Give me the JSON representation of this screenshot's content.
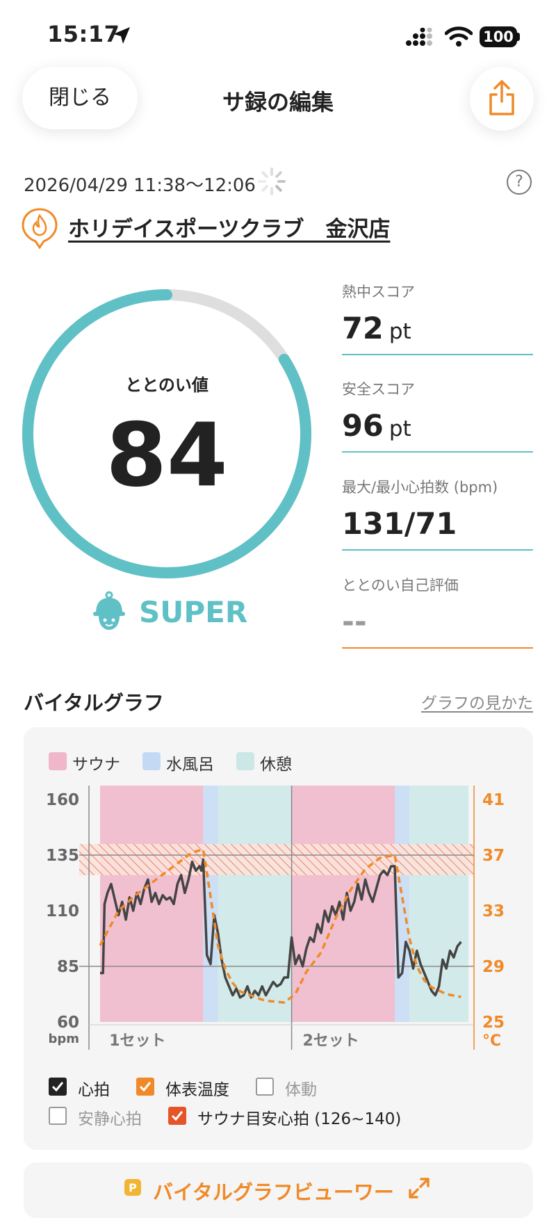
{
  "status_bar": {
    "time": "15:17",
    "battery": "100"
  },
  "header": {
    "close_label": "閉じる",
    "title": "サ録の編集"
  },
  "session": {
    "date": "2026/04/29 11:38～12:06",
    "facility": "ホリデイスポーツクラブ　金沢店",
    "help": "?"
  },
  "score": {
    "label": "ととのい値",
    "value": "84",
    "ring_fraction": 0.84,
    "level": "SUPER",
    "accent_color": "#5fc0c6"
  },
  "metrics": [
    {
      "label": "熱中スコア",
      "value": "72",
      "unit": "pt"
    },
    {
      "label": "安全スコア",
      "value": "96",
      "unit": "pt"
    },
    {
      "label": "最大/最小心拍数 (bpm)",
      "value": "131/71",
      "unit": ""
    },
    {
      "label": "ととのい自己評価",
      "value": "--",
      "unit": ""
    }
  ],
  "vital_graph": {
    "title": "バイタルグラフ",
    "link": "グラフの見かた",
    "legend": [
      {
        "label": "サウナ",
        "color": "#f0b6c9"
      },
      {
        "label": "水風呂",
        "color": "#c4daf4"
      },
      {
        "label": "休憩",
        "color": "#cbe7e6"
      }
    ],
    "checkboxes": [
      {
        "label": "心拍",
        "checked": true,
        "color": "#222222"
      },
      {
        "label": "体表温度",
        "checked": true,
        "color": "#f08a28"
      },
      {
        "label": "体動",
        "checked": false,
        "color": "#999999"
      },
      {
        "label": "安静心拍",
        "checked": false,
        "color": "#999999"
      },
      {
        "label": "サウナ目安心拍 (126~140)",
        "checked": true,
        "color": "#e5552a"
      }
    ]
  },
  "chart_data": {
    "type": "line",
    "y_left": {
      "label": "bpm",
      "ticks": [
        "160",
        "135",
        "110",
        "85",
        "60"
      ],
      "range": [
        60,
        160
      ]
    },
    "y_right": {
      "label": "°C",
      "ticks": [
        "41",
        "37",
        "33",
        "29",
        "25"
      ],
      "range": [
        25,
        41
      ]
    },
    "x_labels": [
      "1セット",
      "2セット"
    ],
    "reference_lines_bpm": [
      135,
      85
    ],
    "target_band_bpm": [
      126,
      140
    ],
    "phases": [
      {
        "type": "サウナ",
        "start": 0,
        "end": 28
      },
      {
        "type": "水風呂",
        "start": 28,
        "end": 32
      },
      {
        "type": "休憩",
        "start": 32,
        "end": 52
      },
      {
        "type": "サウナ",
        "start": 52,
        "end": 80
      },
      {
        "type": "水風呂",
        "start": 80,
        "end": 84
      },
      {
        "type": "休憩",
        "start": 84,
        "end": 100
      }
    ],
    "series": [
      {
        "name": "心拍",
        "color": "#444444",
        "points": [
          [
            0,
            82
          ],
          [
            0.8,
            82
          ],
          [
            1.2,
            113
          ],
          [
            2,
            118
          ],
          [
            3,
            122
          ],
          [
            4,
            115
          ],
          [
            5,
            108
          ],
          [
            6,
            114
          ],
          [
            7,
            106
          ],
          [
            8,
            116
          ],
          [
            9,
            110
          ],
          [
            10,
            118
          ],
          [
            11,
            113
          ],
          [
            12,
            120
          ],
          [
            13,
            124
          ],
          [
            14,
            114
          ],
          [
            15,
            118
          ],
          [
            16,
            113
          ],
          [
            17,
            117
          ],
          [
            18,
            115
          ],
          [
            19,
            116
          ],
          [
            20,
            113
          ],
          [
            21,
            122
          ],
          [
            22,
            126
          ],
          [
            23,
            118
          ],
          [
            24,
            124
          ],
          [
            25,
            132
          ],
          [
            26,
            128
          ],
          [
            27,
            130
          ],
          [
            27.5,
            128
          ],
          [
            28,
            133
          ],
          [
            29,
            90
          ],
          [
            30,
            86
          ],
          [
            31,
            108
          ],
          [
            32,
            100
          ],
          [
            33,
            88
          ],
          [
            34,
            80
          ],
          [
            35,
            76
          ],
          [
            36,
            72
          ],
          [
            37,
            75
          ],
          [
            38,
            71
          ],
          [
            39,
            72
          ],
          [
            40,
            76
          ],
          [
            41,
            71
          ],
          [
            42,
            74
          ],
          [
            43,
            72
          ],
          [
            44,
            76
          ],
          [
            45,
            72
          ],
          [
            46,
            75
          ],
          [
            47,
            78
          ],
          [
            48,
            76
          ],
          [
            49,
            77
          ],
          [
            50,
            80
          ],
          [
            51,
            80
          ],
          [
            52,
            98
          ],
          [
            53,
            86
          ],
          [
            54,
            90
          ],
          [
            55,
            85
          ],
          [
            56,
            93
          ],
          [
            57,
            98
          ],
          [
            58,
            96
          ],
          [
            59,
            104
          ],
          [
            60,
            100
          ],
          [
            61,
            110
          ],
          [
            62,
            105
          ],
          [
            63,
            112
          ],
          [
            64,
            108
          ],
          [
            65,
            114
          ],
          [
            66,
            106
          ],
          [
            67,
            118
          ],
          [
            68,
            110
          ],
          [
            69,
            114
          ],
          [
            70,
            122
          ],
          [
            71,
            115
          ],
          [
            72,
            124
          ],
          [
            73,
            118
          ],
          [
            74,
            114
          ],
          [
            75,
            120
          ],
          [
            76,
            126
          ],
          [
            77,
            128
          ],
          [
            78,
            126
          ],
          [
            79,
            130
          ],
          [
            80,
            130
          ],
          [
            81,
            80
          ],
          [
            82,
            82
          ],
          [
            83,
            96
          ],
          [
            84,
            92
          ],
          [
            85,
            84
          ],
          [
            86,
            92
          ],
          [
            87,
            86
          ],
          [
            88,
            82
          ],
          [
            89,
            78
          ],
          [
            90,
            74
          ],
          [
            91,
            72
          ],
          [
            92,
            76
          ],
          [
            93,
            88
          ],
          [
            94,
            84
          ],
          [
            95,
            92
          ],
          [
            96,
            89
          ],
          [
            97,
            94
          ],
          [
            98,
            96
          ]
        ]
      },
      {
        "name": "体表温度",
        "color": "#f08a28",
        "points": [
          [
            0,
            30.5
          ],
          [
            5,
            33
          ],
          [
            10,
            34.2
          ],
          [
            15,
            35.2
          ],
          [
            20,
            36.2
          ],
          [
            25,
            37.2
          ],
          [
            28,
            37.4
          ],
          [
            30,
            34
          ],
          [
            32,
            30.5
          ],
          [
            34,
            28.8
          ],
          [
            36,
            27.8
          ],
          [
            38,
            27.2
          ],
          [
            40,
            27
          ],
          [
            42,
            26.8
          ],
          [
            44,
            26.6
          ],
          [
            46,
            26.5
          ],
          [
            50,
            26.4
          ],
          [
            53,
            27
          ],
          [
            56,
            28.6
          ],
          [
            60,
            30
          ],
          [
            64,
            32.5
          ],
          [
            68,
            34.5
          ],
          [
            72,
            36
          ],
          [
            76,
            36.8
          ],
          [
            80,
            37
          ],
          [
            82,
            34
          ],
          [
            84,
            31
          ],
          [
            86,
            29
          ],
          [
            88,
            28
          ],
          [
            90,
            27.5
          ],
          [
            94,
            27
          ],
          [
            98,
            26.8
          ]
        ]
      }
    ]
  },
  "viewer": {
    "label": "バイタルグラフビューワー"
  }
}
